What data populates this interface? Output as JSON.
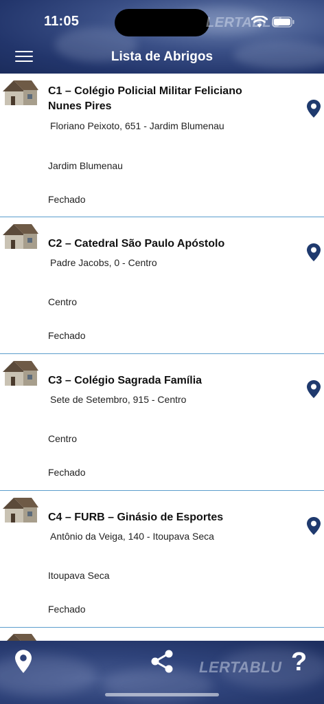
{
  "status_bar": {
    "time": "11:05"
  },
  "header": {
    "title": "Lista de Abrigos",
    "watermark": "LERTABLU"
  },
  "shelters": [
    {
      "title": "C1 – Colégio Policial Militar Feliciano Nunes Pires",
      "address": "Floriano Peixoto, 651 - Jardim Blumenau",
      "neighborhood": "Jardim Blumenau",
      "status": "Fechado"
    },
    {
      "title": "C2 – Catedral  São Paulo Apóstolo",
      "address": "Padre Jacobs, 0 - Centro",
      "neighborhood": "Centro",
      "status": "Fechado"
    },
    {
      "title": "C3 – Colégio Sagrada Família",
      "address": "Sete de Setembro, 915 - Centro",
      "neighborhood": "Centro",
      "status": "Fechado"
    },
    {
      "title": "C4 – FURB – Ginásio de Esportes",
      "address": "Antônio da Veiga, 140 - Itoupava Seca",
      "neighborhood": "Itoupava Seca",
      "status": "Fechado"
    }
  ],
  "bottom_bar": {
    "help_label": "?",
    "watermark": "LERTABLU"
  },
  "colors": {
    "header": "#22356b",
    "pin": "#1f3a6e",
    "divider": "#5a9ccc"
  },
  "icons": [
    "hamburger-menu-icon",
    "house-icon",
    "location-pin-icon",
    "share-icon",
    "help-icon",
    "wifi-icon",
    "battery-icon"
  ]
}
